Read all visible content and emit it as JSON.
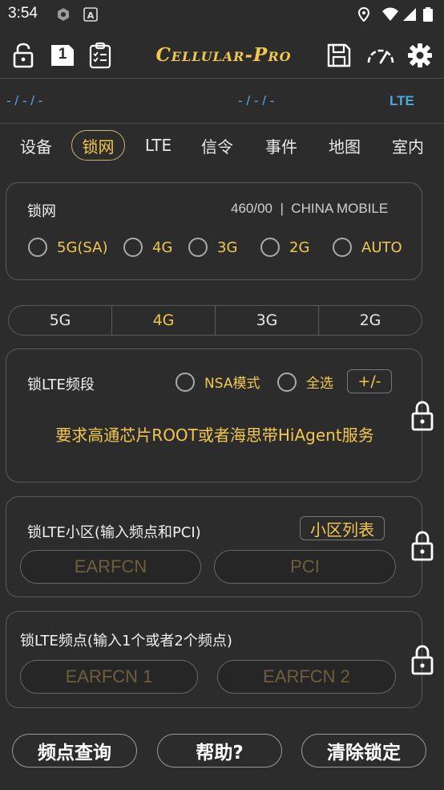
{
  "status_bar": {
    "time": "3:54"
  },
  "toolbar": {
    "brand": "Cellular-Pro",
    "sim_number": "1"
  },
  "info_row": {
    "left": "- / - / -",
    "center": "- / - / -",
    "right": "LTE"
  },
  "tabs": [
    {
      "label": "设备",
      "active": false
    },
    {
      "label": "锁网",
      "active": true
    },
    {
      "label": "LTE",
      "active": false
    },
    {
      "label": "信令",
      "active": false
    },
    {
      "label": "事件",
      "active": false
    },
    {
      "label": "地图",
      "active": false
    },
    {
      "label": "室内",
      "active": false
    }
  ],
  "network_lock": {
    "title": "锁网",
    "operator": "460/00  |  CHINA MOBILE",
    "options": [
      "5G(SA)",
      "4G",
      "3G",
      "2G",
      "AUTO"
    ]
  },
  "rat_segments": [
    {
      "label": "5G",
      "active": false
    },
    {
      "label": "4G",
      "active": true
    },
    {
      "label": "3G",
      "active": false
    },
    {
      "label": "2G",
      "active": false
    }
  ],
  "band_lock": {
    "title": "锁LTE频段",
    "nsa_label": "NSA模式",
    "select_all_label": "全选",
    "toggle_label": "+/-",
    "warning": "要求高通芯片ROOT或者海思带HiAgent服务"
  },
  "cell_lock": {
    "title": "锁LTE小区(输入频点和PCI)",
    "list_button": "小区列表",
    "earfcn_placeholder": "EARFCN",
    "pci_placeholder": "PCI"
  },
  "freq_lock": {
    "title": "锁LTE频点(输入1个或者2个频点)",
    "earfcn1_placeholder": "EARFCN 1",
    "earfcn2_placeholder": "EARFCN 2"
  },
  "bottom_buttons": {
    "query": "频点查询",
    "help": "帮助?",
    "clear": "清除锁定"
  },
  "colors": {
    "accent": "#f3c74d",
    "info_blue": "#4fa8e0",
    "background": "#2c2c2c",
    "border": "#5b5b5b"
  }
}
